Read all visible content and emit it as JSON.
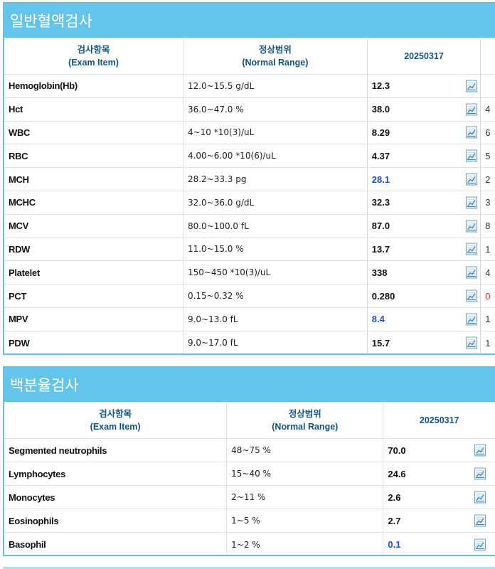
{
  "sections": [
    {
      "title": "일반혈액검사",
      "headers": {
        "item_ko": "검사항목",
        "item_en": "(Exam Item)",
        "range_ko": "정상범위",
        "range_en": "(Normal Range)",
        "date": "20250317"
      },
      "rows": [
        {
          "name": "Hemoglobin(Hb)",
          "range": "12.0~15.5 g/dL",
          "value": "12.3",
          "flag": "normal"
        },
        {
          "name": "Hct",
          "range": "36.0~47.0 %",
          "value": "38.0",
          "flag": "normal"
        },
        {
          "name": "WBC",
          "range": "4~10 *10(3)/uL",
          "value": "8.29",
          "flag": "normal"
        },
        {
          "name": "RBC",
          "range": "4.00~6.00 *10(6)/uL",
          "value": "4.37",
          "flag": "normal"
        },
        {
          "name": "MCH",
          "range": "28.2~33.3 pg",
          "value": "28.1",
          "flag": "low"
        },
        {
          "name": "MCHC",
          "range": "32.0~36.0 g/dL",
          "value": "32.3",
          "flag": "normal"
        },
        {
          "name": "MCV",
          "range": "80.0~100.0 fL",
          "value": "87.0",
          "flag": "normal"
        },
        {
          "name": "RDW",
          "range": "11.0~15.0 %",
          "value": "13.7",
          "flag": "normal"
        },
        {
          "name": "Platelet",
          "range": "150~450 *10(3)/uL",
          "value": "338",
          "flag": "normal"
        },
        {
          "name": "PCT",
          "range": "0.15~0.32 %",
          "value": "0.280",
          "flag": "normal"
        },
        {
          "name": "MPV",
          "range": "9.0~13.0 fL",
          "value": "8.4",
          "flag": "low"
        },
        {
          "name": "PDW",
          "range": "9.0~17.0 fL",
          "value": "15.7",
          "flag": "normal"
        }
      ],
      "extra_column": [
        "",
        "4",
        "6",
        "5",
        "2",
        "3",
        "8",
        "1",
        "4",
        "0",
        "1",
        "1"
      ]
    },
    {
      "title": "백분율검사",
      "headers": {
        "item_ko": "검사항목",
        "item_en": "(Exam Item)",
        "range_ko": "정상범위",
        "range_en": "(Normal Range)",
        "date": "20250317"
      },
      "rows": [
        {
          "name": "Segmented neutrophils",
          "range": "48~75 %",
          "value": "70.0",
          "flag": "normal"
        },
        {
          "name": "Lymphocytes",
          "range": "15~40 %",
          "value": "24.6",
          "flag": "normal"
        },
        {
          "name": "Monocytes",
          "range": "2~11 %",
          "value": "2.6",
          "flag": "normal"
        },
        {
          "name": "Eosinophils",
          "range": "1~5 %",
          "value": "2.7",
          "flag": "normal"
        },
        {
          "name": "Basophil",
          "range": "1~2 %",
          "value": "0.1",
          "flag": "low"
        }
      ]
    }
  ],
  "colors": {
    "header_bar": "#63c5ea",
    "border": "#5cc2e8",
    "header_text": "#135580",
    "low_value": "#1a4fd6",
    "high_value": "#e0281c"
  },
  "icons": {
    "history_chart": "line-chart-icon"
  }
}
